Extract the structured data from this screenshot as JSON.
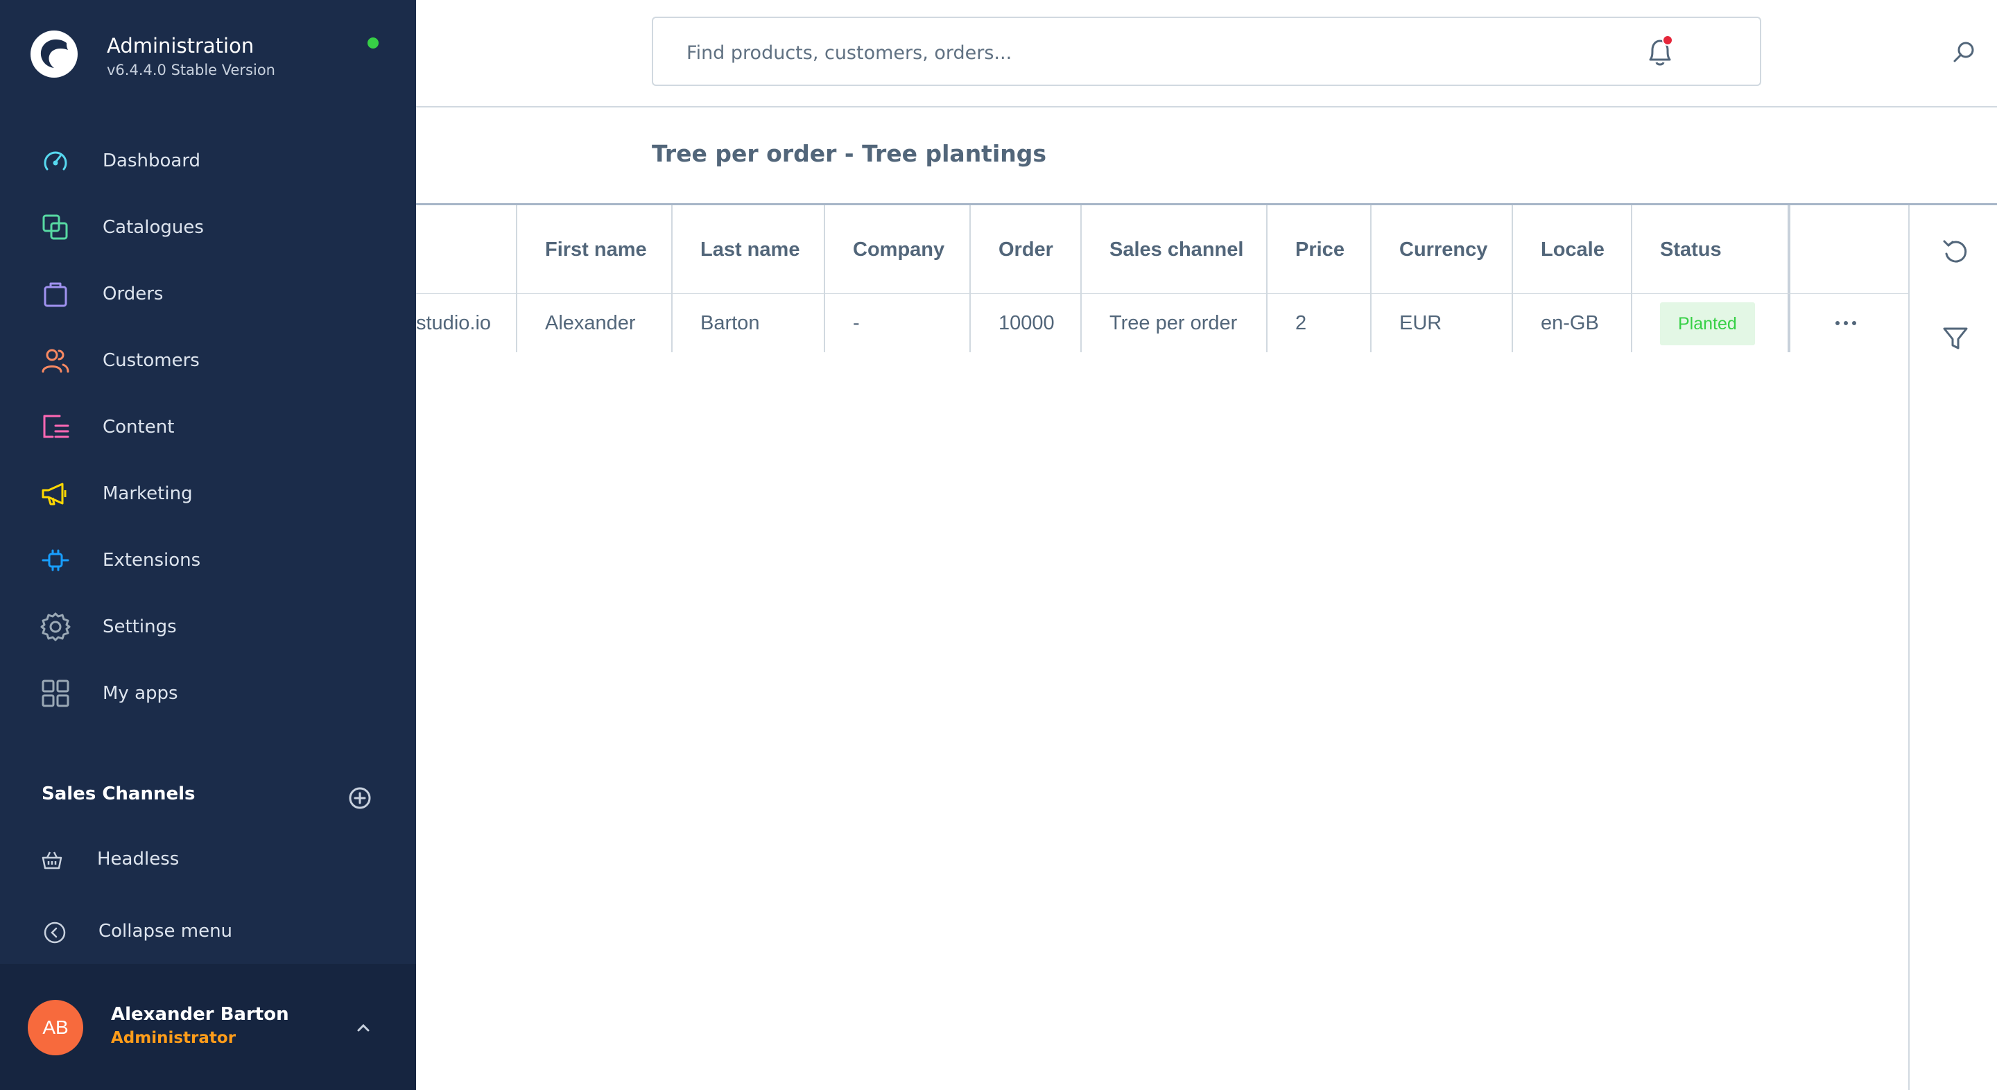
{
  "app": {
    "title": "Administration",
    "version": "v6.4.4.0 Stable Version",
    "status_color": "#37d046"
  },
  "nav": {
    "items": [
      {
        "label": "Dashboard",
        "icon": "dashboard-gauge-icon",
        "color": "#57d9f0"
      },
      {
        "label": "Catalogues",
        "icon": "catalogues-icon",
        "color": "#57d9a3"
      },
      {
        "label": "Orders",
        "icon": "orders-bag-icon",
        "color": "#a092f0"
      },
      {
        "label": "Customers",
        "icon": "customers-icon",
        "color": "#f88962"
      },
      {
        "label": "Content",
        "icon": "content-icon",
        "color": "#ff68b4"
      },
      {
        "label": "Marketing",
        "icon": "marketing-megaphone-icon",
        "color": "#ffd700"
      },
      {
        "label": "Extensions",
        "icon": "extensions-plug-icon",
        "color": "#189eff"
      },
      {
        "label": "Settings",
        "icon": "settings-gear-icon",
        "color": "#9aa8b5"
      },
      {
        "label": "My apps",
        "icon": "my-apps-grid-icon",
        "color": "#9aa8b5"
      }
    ]
  },
  "sales_channels": {
    "header": "Sales Channels",
    "items": [
      {
        "label": "Headless",
        "icon": "basket-icon"
      }
    ]
  },
  "collapse_label": "Collapse menu",
  "user": {
    "initials": "AB",
    "name": "Alexander Barton",
    "role": "Administrator"
  },
  "search": {
    "placeholder": "Find products, customers, orders..."
  },
  "page": {
    "title": "Tree per order - Tree plantings"
  },
  "grid": {
    "columns": [
      "",
      "First name",
      "Last name",
      "Company",
      "Order",
      "Sales channel",
      "Price",
      "Currency",
      "Locale",
      "Status"
    ],
    "rows": [
      {
        "email_fragment": "studio.io",
        "first_name": "Alexander",
        "last_name": "Barton",
        "company": "-",
        "order": "10000",
        "sales_channel": "Tree per order",
        "price": "2",
        "currency": "EUR",
        "locale": "en-GB",
        "status": "Planted"
      }
    ]
  }
}
